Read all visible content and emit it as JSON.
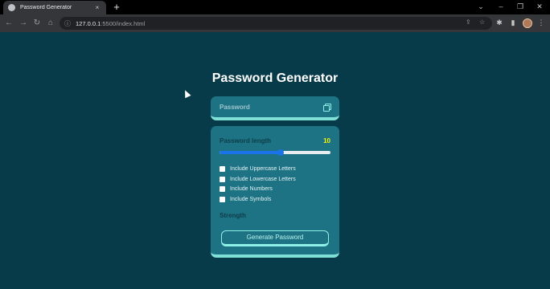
{
  "browser": {
    "tab_title": "Password Generator",
    "tab_close": "×",
    "new_tab": "+",
    "url_host": "127.0.0.1",
    "url_rest": ":5500/index.html",
    "window_controls": {
      "tabsearch": "⌄",
      "minimize": "–",
      "restore": "❐",
      "close": "✕"
    },
    "nav": {
      "back": "←",
      "forward": "→",
      "reload": "↻",
      "home": "⌂"
    },
    "info_icon": "ⓘ",
    "share_icon": "⇪",
    "star_icon": "☆",
    "extensions_icon": "✱",
    "sidepanel_icon": "▮",
    "menu_icon": "⋮"
  },
  "app": {
    "title": "Password Generator",
    "password_placeholder": "Password",
    "length_label": "Password length",
    "length_value": "10",
    "slider_level": 0.55,
    "options": [
      {
        "label": "Include Uppercase Letters",
        "checked": false
      },
      {
        "label": "Include Lowercase Letters",
        "checked": false
      },
      {
        "label": "Include Numbers",
        "checked": false
      },
      {
        "label": "Include Symbols",
        "checked": false
      }
    ],
    "strength_label": "Strength",
    "generate_label": "Generate Password"
  },
  "colors": {
    "page_bg": "#083b4a",
    "card_bg": "#1d7384",
    "card_accent": "#7fe0d6",
    "length_value": "#f7f30b",
    "slider_fill": "#1a73e8"
  }
}
